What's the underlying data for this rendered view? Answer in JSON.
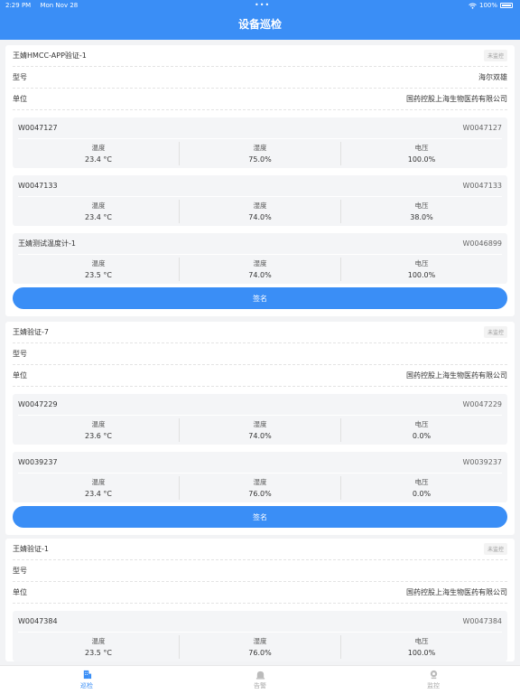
{
  "status": {
    "time": "2:29 PM",
    "date": "Mon Nov 28",
    "battery": "100%"
  },
  "header": {
    "title": "设备巡检"
  },
  "labels": {
    "model": "型号",
    "unit": "单位",
    "temperature": "温度",
    "humidity": "湿度",
    "voltage": "电压"
  },
  "cards": [
    {
      "name": "王婧HMCC-APP验证-1",
      "badge": "未监控",
      "model": "海尔双雄",
      "unit": "国药控股上海生物医药有限公司",
      "devices": [
        {
          "name": "W0047127",
          "code": "W0047127",
          "temperature": "23.4 °C",
          "humidity": "75.0%",
          "voltage": "100.0%"
        },
        {
          "name": "W0047133",
          "code": "W0047133",
          "temperature": "23.4 °C",
          "humidity": "74.0%",
          "voltage": "38.0%"
        },
        {
          "name": "王婧测试温度计-1",
          "code": "W0046899",
          "temperature": "23.5 °C",
          "humidity": "74.0%",
          "voltage": "100.0%"
        }
      ],
      "sign_label": "签名"
    },
    {
      "name": "王婧验证-7",
      "badge": "未监控",
      "model": "",
      "unit": "国药控股上海生物医药有限公司",
      "devices": [
        {
          "name": "W0047229",
          "code": "W0047229",
          "temperature": "23.6 °C",
          "humidity": "74.0%",
          "voltage": "0.0%"
        },
        {
          "name": "W0039237",
          "code": "W0039237",
          "temperature": "23.4 °C",
          "humidity": "76.0%",
          "voltage": "0.0%"
        }
      ],
      "sign_label": "签名"
    },
    {
      "name": "王婧验证-1",
      "badge": "未监控",
      "model": "",
      "unit": "国药控股上海生物医药有限公司",
      "devices": [
        {
          "name": "W0047384",
          "code": "W0047384",
          "temperature": "23.5 °C",
          "humidity": "76.0%",
          "voltage": "100.0%"
        }
      ]
    }
  ],
  "tabbar": {
    "items": [
      {
        "label": "巡检",
        "icon": "building-icon",
        "active": true
      },
      {
        "label": "告警",
        "icon": "alarm-icon",
        "active": false
      },
      {
        "label": "监控",
        "icon": "camera-icon",
        "active": false
      }
    ],
    "active_color": "#3a8ef6"
  }
}
